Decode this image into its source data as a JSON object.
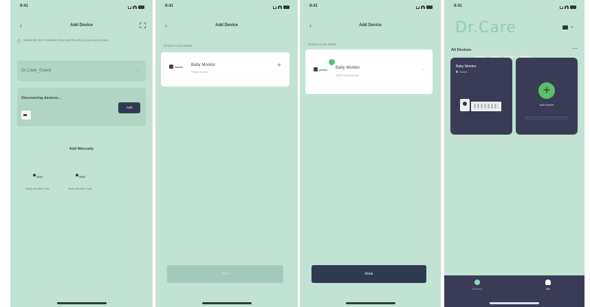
{
  "accent_colors": {
    "background": "#c2e2d4",
    "dark_button": "#2f3a4f",
    "brand": "#8ad2b6",
    "status_green": "#5cbf6a"
  },
  "panel1": {
    "status_time": "9:41",
    "nav_title": "Add Device",
    "hint_text": "Select the Wi-Fi network, then add the device you want to use.",
    "wifi_name": "Dr.Care_Guest",
    "discovering_title": "Discovering devices...",
    "add_button": "Add",
    "manual_title": "Add Manually",
    "manual_devices": [
      {
        "label": "Baby Monitor Cube"
      },
      {
        "label": "Baby Monitor Cube"
      }
    ]
  },
  "panel2": {
    "status_time": "9:41",
    "nav_title": "Add Device",
    "section_label": "Devices to be added",
    "device_name": "Baby Monitor",
    "device_sub": "Ready to add",
    "bottom_button": "Next"
  },
  "panel3": {
    "status_time": "9:41",
    "nav_title": "Add Device",
    "section_label": "Devices to be added",
    "device_name": "Baby Monitor",
    "device_sub": "Added successfully",
    "bottom_button": "Done"
  },
  "panel4": {
    "status_time": "9:41",
    "brand": "Dr.Care",
    "all_devices": "All Devices",
    "device_tile": {
      "name": "Baby Monitor",
      "status": "Online"
    },
    "add_tile_caption": "Add Device",
    "tabs": [
      {
        "label": "Devices"
      },
      {
        "label": "Me"
      }
    ]
  }
}
